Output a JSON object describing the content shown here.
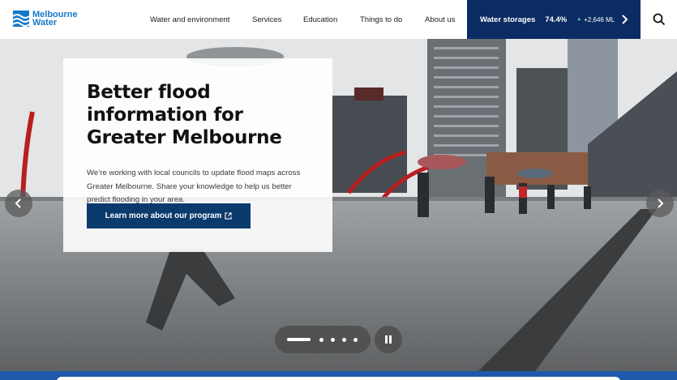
{
  "header": {
    "logo": {
      "line1": "Melbourne",
      "line2": "Water",
      "icon": "wave-logo-icon"
    },
    "nav": [
      {
        "label": "Water and environment"
      },
      {
        "label": "Services"
      },
      {
        "label": "Education"
      },
      {
        "label": "Things to do"
      },
      {
        "label": "About us"
      }
    ],
    "storage": {
      "label": "Water storages",
      "percent": "74.4%",
      "trend_icon": "triangle-up-icon",
      "change": "+2,646 ML",
      "chevron": "chevron-right-icon"
    },
    "search_icon": "search-icon"
  },
  "hero": {
    "title": "Better flood information for Greater Melbourne",
    "body": "We’re working with local councils to update flood maps across Greater Melbourne. Share your knowledge to help us better predict flooding in your area.",
    "cta_label": "Learn more about our program",
    "cta_icon": "external-link-icon",
    "prev_icon": "chevron-left-icon",
    "next_icon": "chevron-right-icon",
    "slides": {
      "count": 5,
      "active": 1
    },
    "pause_icon": "pause-icon"
  },
  "colors": {
    "brand_blue": "#1478c8",
    "navy": "#0b2c63",
    "button_navy": "#0b3a6d",
    "accent_teal": "#5fd3c8"
  }
}
